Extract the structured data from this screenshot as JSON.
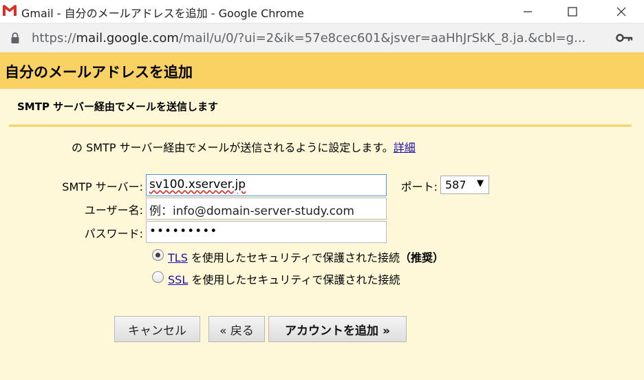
{
  "window": {
    "title": "Gmail - 自分のメールアドレスを追加 - Google Chrome"
  },
  "addressbar": {
    "url_scheme": "https://",
    "url_host": "mail.google.com",
    "url_path": "/mail/u/0/?ui=2&ik=57e8cec601&jsver=aaHhJrSkK_8.ja.&cbl=g..."
  },
  "page": {
    "title": "自分のメールアドレスを追加",
    "section_heading": "SMTP サーバー経由でメールを送信します",
    "description": "の SMTP サーバー経由でメールが送信されるように設定します。",
    "details_link": "詳細"
  },
  "form": {
    "smtp_label": "SMTP サーバー:",
    "smtp_value": "sv100.xserver.jp",
    "port_label": "ポート:",
    "port_value": "587",
    "username_label": "ユーザー名:",
    "username_value": "例：info@domain-server-study.com",
    "password_label": "パスワード:",
    "password_value": "•••••••••",
    "tls_link": "TLS",
    "tls_text": " を使用したセキュリティで保護された接続",
    "tls_recommended": "（推奨）",
    "ssl_link": "SSL",
    "ssl_text": " を使用したセキュリティで保護された接続"
  },
  "buttons": {
    "cancel": "キャンセル",
    "back": "« 戻る",
    "add_account": "アカウントを追加 »"
  },
  "colors": {
    "header_band": "#fad163",
    "page_background": "#fff8d8",
    "link": "#1a0dab",
    "focus_border": "#4d90fe"
  }
}
